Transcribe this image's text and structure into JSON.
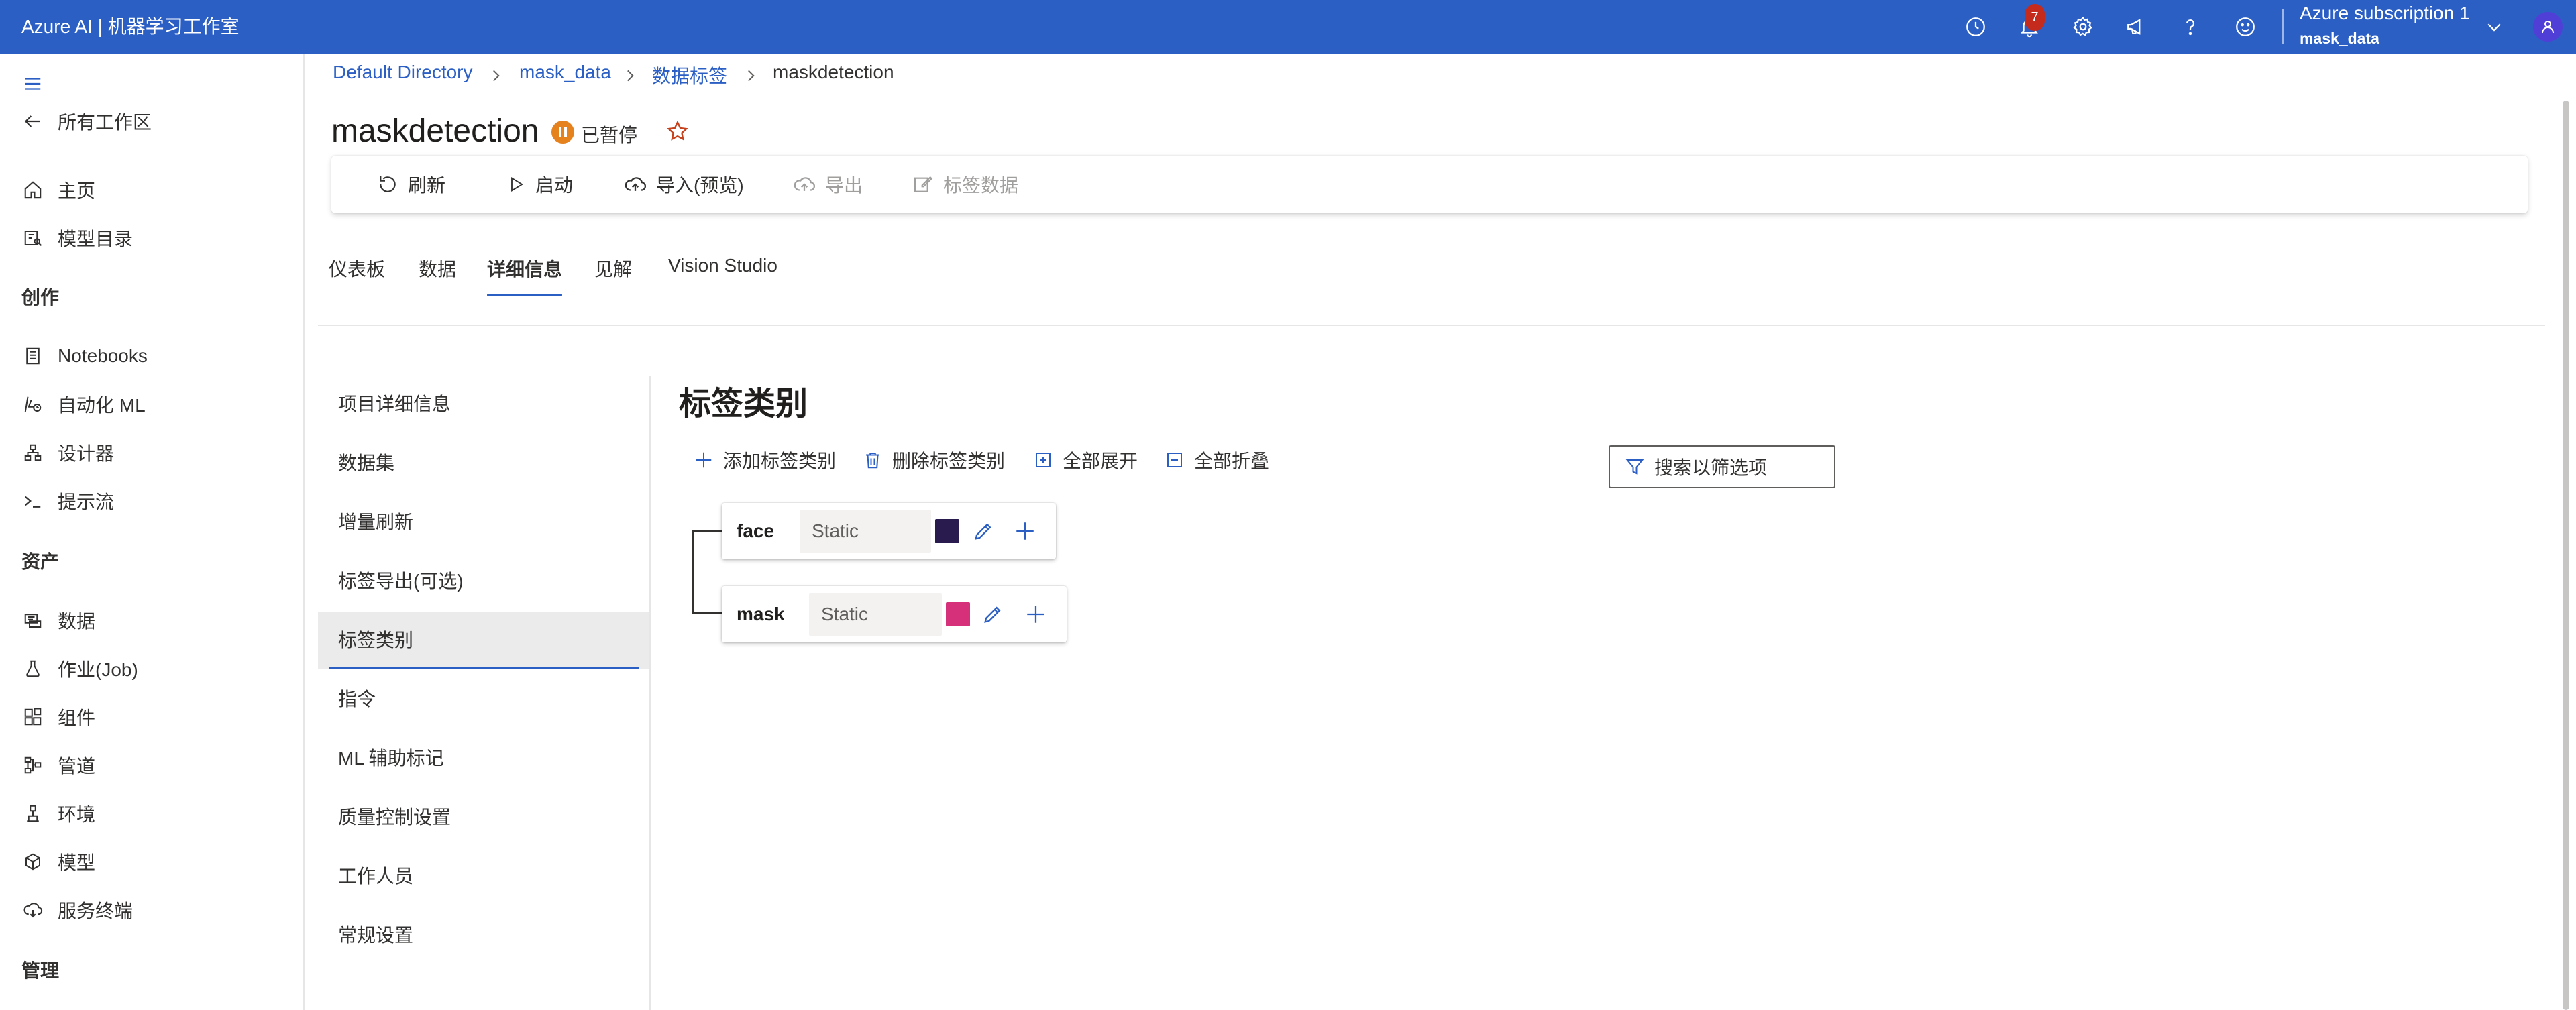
{
  "app": {
    "title": "Azure AI | 机器学习工作室"
  },
  "topbar": {
    "notification_count": "7",
    "subscription_name": "Azure subscription 1",
    "workspace_name": "mask_data",
    "brand_color": "#2b5fc4",
    "icons": [
      "clock-icon",
      "bell-icon",
      "gear-icon",
      "megaphone-icon",
      "help-icon",
      "smiley-icon",
      "chevron-down-icon",
      "avatar-person-icon"
    ]
  },
  "nav": {
    "back_label": "所有工作区",
    "items_top": [
      {
        "label": "主页",
        "icon": "home-icon"
      },
      {
        "label": "模型目录",
        "icon": "catalog-icon"
      }
    ],
    "sections": {
      "author": "创作",
      "assets": "资产",
      "manage": "管理"
    },
    "author_items": [
      {
        "label": "Notebooks",
        "icon": "notebook-icon"
      },
      {
        "label": "自动化 ML",
        "icon": "automl-icon"
      },
      {
        "label": "设计器",
        "icon": "designer-icon"
      },
      {
        "label": "提示流",
        "icon": "promptflow-icon"
      }
    ],
    "asset_items": [
      {
        "label": "数据",
        "icon": "data-icon"
      },
      {
        "label": "作业(Job)",
        "icon": "flask-icon"
      },
      {
        "label": "组件",
        "icon": "component-icon"
      },
      {
        "label": "管道",
        "icon": "pipeline-icon"
      },
      {
        "label": "环境",
        "icon": "environment-icon"
      },
      {
        "label": "模型",
        "icon": "model-icon"
      },
      {
        "label": "服务终端",
        "icon": "endpoint-icon"
      }
    ]
  },
  "breadcrumb": [
    "Default Directory",
    "mask_data",
    "数据标签",
    "maskdetection"
  ],
  "project": {
    "title": "maskdetection",
    "status": "已暂停",
    "status_color": "#e6821e"
  },
  "toolbar": {
    "refresh": "刷新",
    "start": "启动",
    "import": "导入(预览)",
    "export": "导出",
    "label_data": "标签数据"
  },
  "tabs": [
    "仪表板",
    "数据",
    "详细信息",
    "见解",
    "Vision Studio"
  ],
  "active_tab": "详细信息",
  "submenu": [
    "项目详细信息",
    "数据集",
    "增量刷新",
    "标签导出(可选)",
    "标签类别",
    "指令",
    "ML 辅助标记",
    "质量控制设置",
    "工作人员",
    "常规设置"
  ],
  "active_submenu": "标签类别",
  "content": {
    "title": "标签类别",
    "commands": {
      "add": "添加标签类别",
      "delete": "删除标签类别",
      "expand": "全部展开",
      "collapse": "全部折叠"
    },
    "filter_placeholder": "搜索以筛选项",
    "labels": [
      {
        "name": "face",
        "type": "Static",
        "color": "#2a1b4f"
      },
      {
        "name": "mask",
        "type": "Static",
        "color": "#d6307a"
      }
    ]
  }
}
